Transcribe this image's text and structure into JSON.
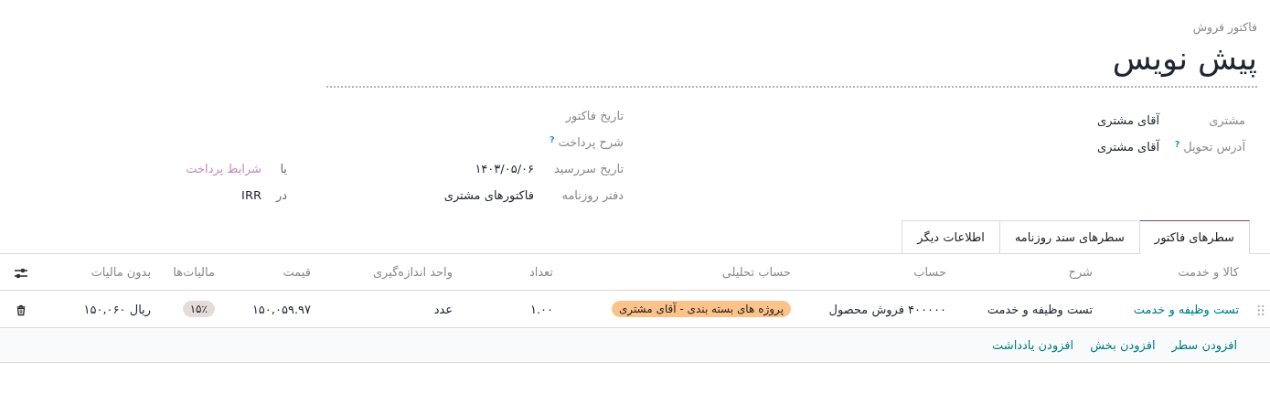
{
  "document": {
    "type_label": "فاکتور فروش",
    "title": "پیش نویس"
  },
  "fields_right": [
    {
      "label": "مشتری",
      "value": "آقای مشتری"
    },
    {
      "label": "آدرس تحویل",
      "help": "?",
      "value": "آقای مشتری"
    }
  ],
  "fields_middle": [
    {
      "label": "تاریخ فاکتور"
    },
    {
      "label": "شرح پرداخت",
      "help": "?"
    },
    {
      "label": "تاریخ سررسید",
      "value": "۱۴۰۳/۰۵/۰۶",
      "side": {
        "prefix": "یا",
        "placeholder": "شرایط پرداخت"
      }
    },
    {
      "label": "دفتر روزنامه",
      "value": "فاکتورهای مشتری",
      "side": {
        "prefix": "در",
        "value": "IRR"
      }
    }
  ],
  "tabs": [
    {
      "label": "سطرهای فاکتور",
      "selected": true
    },
    {
      "label": "سطرهای سند روزنامه",
      "selected": false
    },
    {
      "label": "اطلاعات دیگر",
      "selected": false
    }
  ],
  "table": {
    "columns": [
      "کالا و خدمت",
      "شرح",
      "حساب",
      "حساب تحلیلی",
      "تعداد",
      "واحد اندازه‌گیری",
      "قیمت",
      "مالیات‌ها",
      "بدون مالیات"
    ],
    "rows": [
      {
        "product": "تست وظیفه و خدمت",
        "description": "تست وظیفه و خدمت",
        "account": "۴۰۰۰۰۰ فروش محصول",
        "analytic_tags": [
          {
            "label": "پروژه های بسته بندی - آقای مشتری",
            "color": "#fbc28a"
          }
        ],
        "quantity": "۱.۰۰",
        "uom": "عدد",
        "price": "۱۵۰,۰۵۹.۹۷",
        "taxes": [
          {
            "label": "۱۵٪",
            "color": "#e6dbdb"
          }
        ],
        "subtotal": "ریال ۱۵۰,۰۶۰"
      }
    ],
    "add_actions": [
      "افزودن سطر",
      "افزودن بخش",
      "افزودن یادداشت"
    ]
  }
}
